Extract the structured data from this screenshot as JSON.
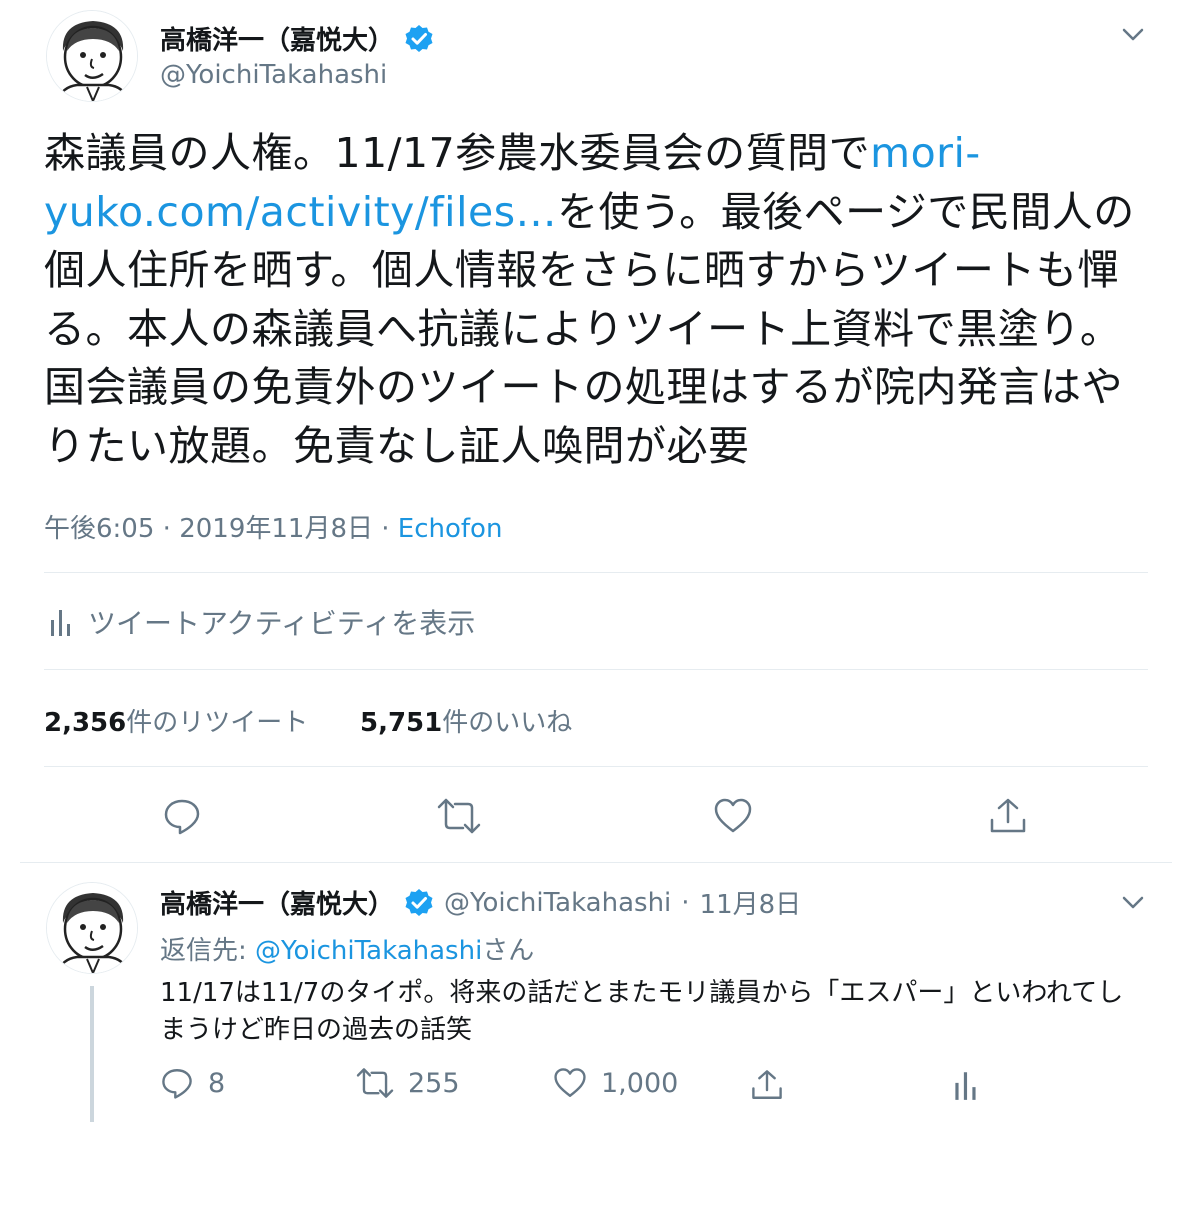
{
  "main_tweet": {
    "author_name": "高橋洋一（嘉悦大）",
    "handle": "@YoichiTakahashi",
    "text_before_link": "森議員の人権。11/17参農水委員会の質問で",
    "link_text": "mori-yuko.com/activity/files…",
    "text_after_link": "を使う。最後ページで民間人の個人住所を晒す。個人情報をさらに晒すからツイートも憚る。本人の森議員へ抗議によりツイート上資料で黒塗り。国会議員の免責外のツイートの処理はするが院内発言はやりたい放題。免責なし証人喚問が必要",
    "time": "午後6:05",
    "date": "2019年11月8日",
    "source": "Echofon",
    "activity_label": "ツイートアクティビティを表示",
    "retweet_count": "2,356",
    "retweet_suffix": "件のリツイート",
    "like_count": "5,751",
    "like_suffix": "件のいいね"
  },
  "reply_tweet": {
    "author_name": "高橋洋一（嘉悦大）",
    "handle": "@YoichiTakahashi",
    "date": "11月8日",
    "reply_to_prefix": "返信先: ",
    "reply_to_handle": "@YoichiTakahashi",
    "reply_to_suffix": "さん",
    "text": "11/17は11/7のタイポ。将来の話だとまたモリ議員から「エスパー」といわれてしまうけど昨日の過去の話笑",
    "reply_count": "8",
    "retweet_count": "255",
    "like_count": "1,000"
  },
  "icons": [
    "verified-icon",
    "chevron-down-icon",
    "bar-chart-icon",
    "reply-icon",
    "retweet-icon",
    "like-icon",
    "share-icon"
  ],
  "colors": {
    "accent": "#1b95e0",
    "verified": "#1da1f2",
    "text": "#14171a",
    "secondary": "#657786",
    "divider": "#e6ecf0"
  }
}
